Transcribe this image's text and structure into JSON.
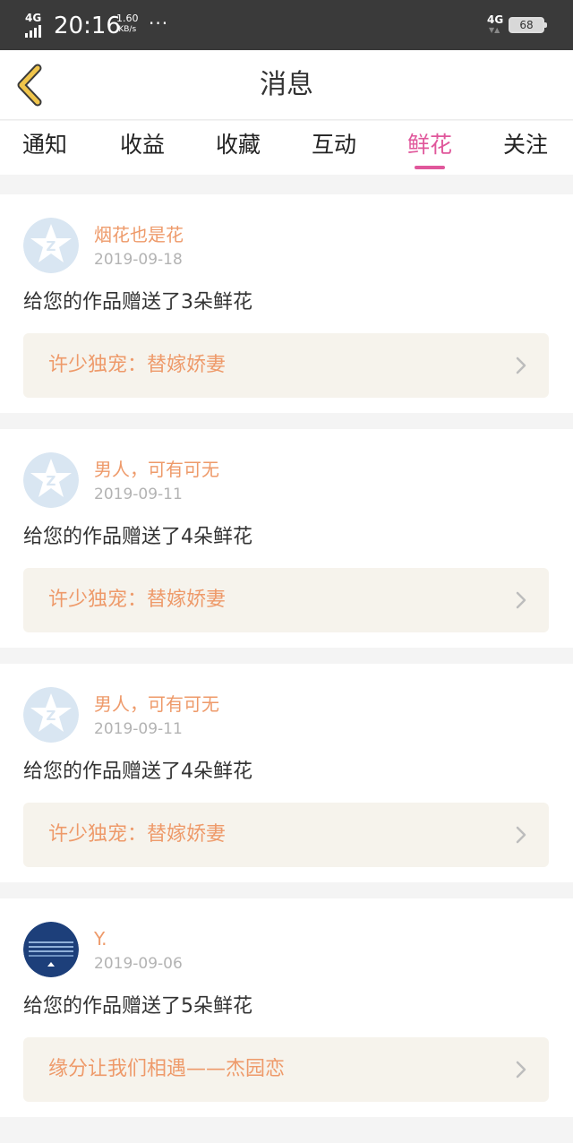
{
  "status_bar": {
    "network": "4G",
    "time": "20:16",
    "speed_value": "1.60",
    "speed_unit": "KB/s",
    "more": "···",
    "network_right": "4G",
    "battery": "68"
  },
  "header": {
    "title": "消息"
  },
  "tabs": [
    {
      "label": "通知",
      "active": false
    },
    {
      "label": "收益",
      "active": false
    },
    {
      "label": "收藏",
      "active": false
    },
    {
      "label": "互动",
      "active": false
    },
    {
      "label": "鲜花",
      "active": true
    },
    {
      "label": "关注",
      "active": false
    }
  ],
  "messages": [
    {
      "user": "烟花也是花",
      "date": "2019-09-18",
      "text": "给您的作品赠送了3朵鲜花",
      "work": "许少独宠：替嫁娇妻",
      "avatar": "default-star-avatar"
    },
    {
      "user": "男人，可有可无",
      "date": "2019-09-11",
      "text": "给您的作品赠送了4朵鲜花",
      "work": "许少独宠：替嫁娇妻",
      "avatar": "default-star-avatar"
    },
    {
      "user": "男人，可有可无",
      "date": "2019-09-11",
      "text": "给您的作品赠送了4朵鲜花",
      "work": "许少独宠：替嫁娇妻",
      "avatar": "default-star-avatar"
    },
    {
      "user": "Y.",
      "date": "2019-09-06",
      "text": "给您的作品赠送了5朵鲜花",
      "work": "缘分让我们相遇——杰园恋",
      "avatar": "navy-lake-avatar"
    }
  ],
  "colors": {
    "accent": "#e0579b",
    "name": "#ee9a6a",
    "back_arrow": "#f0c54b"
  }
}
